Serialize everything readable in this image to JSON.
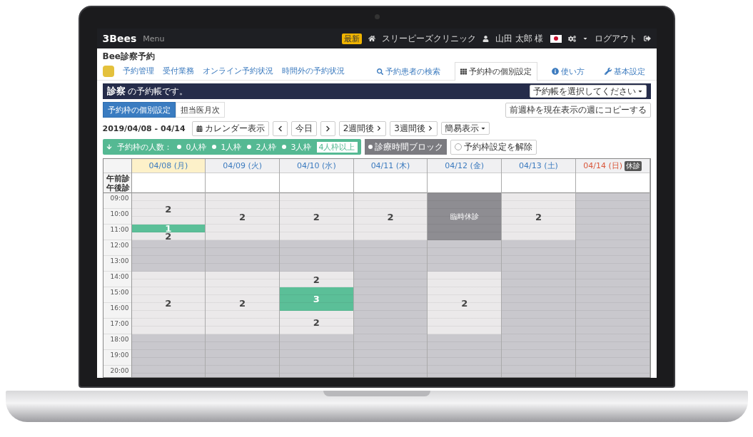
{
  "topbar": {
    "logo": "3Bees",
    "menu": "Menu",
    "badge": "最新",
    "clinic": "スリーピーズクリニック",
    "user": "山田 太郎 様",
    "logout": "ログアウト"
  },
  "page_title": "Bee診察予約",
  "nav": {
    "links": [
      "予約管理",
      "受付業務",
      "オンライン予約状況",
      "時間外の予約状況"
    ],
    "tabs": [
      {
        "label": "予約患者の検索",
        "selected": false
      },
      {
        "label": "予約枠の個別設定",
        "selected": true
      },
      {
        "label": "使い方",
        "selected": false
      },
      {
        "label": "基本設定",
        "selected": false
      }
    ]
  },
  "banner": {
    "text": "**診察** の予約帳です。",
    "select": "予約帳を選択してください"
  },
  "view_tabs": [
    {
      "label": "予約枠の個別設定",
      "selected": true
    },
    {
      "label": "担当医月次",
      "selected": false
    }
  ],
  "copy_button": "前週枠を現在表示の週にコピーする",
  "toolbar": {
    "range": "2019/04/08 - 04/14",
    "calendar": "カレンダー表示",
    "today": "今日",
    "two_weeks": "2週間後",
    "three_weeks": "3週間後",
    "display": "簡易表示"
  },
  "filter": {
    "label": "予約枠の人数：",
    "options": [
      "0人枠",
      "1人枠",
      "2人枠",
      "3人枠"
    ],
    "select": "4人枠以上",
    "block_button": "診療時間ブロック",
    "clear": {
      "label": "予約枠設定を解除",
      "checked": false
    }
  },
  "calendar": {
    "session_labels": [
      "午前診",
      "午後診"
    ],
    "times": [
      "09:00",
      "10:00",
      "11:00",
      "12:00",
      "13:00",
      "14:00",
      "15:00",
      "16:00",
      "17:00",
      "18:00",
      "19:00",
      "20:00"
    ],
    "days": [
      {
        "label": "04/08 (月)",
        "kind": "weekday",
        "today": true,
        "blocks": [
          {
            "kind": "open",
            "label": "2"
          },
          {
            "kind": "booked",
            "label": "1"
          },
          {
            "kind": "open",
            "label": "2"
          },
          {
            "kind": "closed"
          },
          {
            "kind": "open",
            "label": "2"
          },
          {
            "kind": "closed"
          }
        ]
      },
      {
        "label": "04/09 (火)",
        "kind": "weekday",
        "today": false,
        "blocks": [
          {
            "kind": "open",
            "label": "2"
          },
          {
            "kind": "closed"
          },
          {
            "kind": "open",
            "label": "2"
          },
          {
            "kind": "closed"
          }
        ]
      },
      {
        "label": "04/10 (水)",
        "kind": "weekday",
        "today": false,
        "blocks": [
          {
            "kind": "open",
            "label": "2"
          },
          {
            "kind": "closed"
          },
          {
            "kind": "open",
            "label": "2"
          },
          {
            "kind": "booked",
            "label": "3"
          },
          {
            "kind": "open",
            "label": "2"
          },
          {
            "kind": "closed"
          }
        ]
      },
      {
        "label": "04/11 (木)",
        "kind": "weekday",
        "today": false,
        "blocks": [
          {
            "kind": "open",
            "label": "2"
          },
          {
            "kind": "closed"
          }
        ]
      },
      {
        "label": "04/12 (金)",
        "kind": "weekday",
        "today": false,
        "blocks": [
          {
            "kind": "blocked",
            "label": "臨時休診"
          },
          {
            "kind": "closed"
          },
          {
            "kind": "open",
            "label": "2"
          },
          {
            "kind": "closed"
          }
        ]
      },
      {
        "label": "04/13 (土)",
        "kind": "weekday",
        "today": false,
        "blocks": [
          {
            "kind": "open",
            "label": "2"
          },
          {
            "kind": "closed"
          }
        ]
      },
      {
        "label": "04/14 (日)",
        "kind": "holiday",
        "today": false,
        "badge": "休診",
        "blocks": [
          {
            "kind": "closed"
          }
        ]
      }
    ]
  }
}
